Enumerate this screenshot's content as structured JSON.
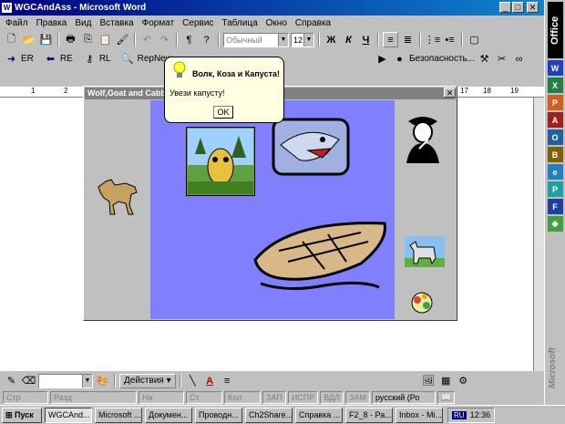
{
  "window": {
    "title": "WGCAndAss - Microsoft Word"
  },
  "menu": [
    "Файл",
    "Правка",
    "Вид",
    "Вставка",
    "Формат",
    "Сервис",
    "Таблица",
    "Окно",
    "Справка"
  ],
  "format_toolbar": {
    "style": "Обычный",
    "size": "12",
    "bold": "Ж",
    "italic": "К",
    "underline": "Ч"
  },
  "macro_toolbar": {
    "items": [
      "ER",
      "RE",
      "RL",
      "RepNew"
    ],
    "security": "Безопасность..."
  },
  "game": {
    "title": "Wolf,Goat and Cabbage"
  },
  "dialog": {
    "title": "Волк, Коза и Капуста!",
    "message": "Увези капусту!",
    "ok": "OK"
  },
  "ruler": {
    "marks": [
      "1",
      "2",
      "17",
      "18",
      "19"
    ]
  },
  "draw_toolbar": {
    "actions": "Действия"
  },
  "status": {
    "items": [
      "Стр",
      "Разд",
      "На",
      "Ст",
      "Кол",
      "ЗАП",
      "ИСПР",
      "ВДЛ",
      "ЗАМ"
    ],
    "language": "русский (Ро"
  },
  "taskbar": {
    "start": "Пуск",
    "tasks": [
      "WGCAnd...",
      "Microsoft ...",
      "Докумен...",
      "Проводн...",
      "Ch2Share...",
      "Справка ...",
      "F2_8 - Ра...",
      "Inbox - Mi..."
    ],
    "lang": "RU",
    "clock": "12:36"
  },
  "office_bar": {
    "label": "Office",
    "brand": "Microsoft"
  },
  "colors": {
    "title_start": "#000080",
    "title_end": "#1084d0",
    "river": "#8080ff",
    "bank": "#c0c0c0"
  }
}
